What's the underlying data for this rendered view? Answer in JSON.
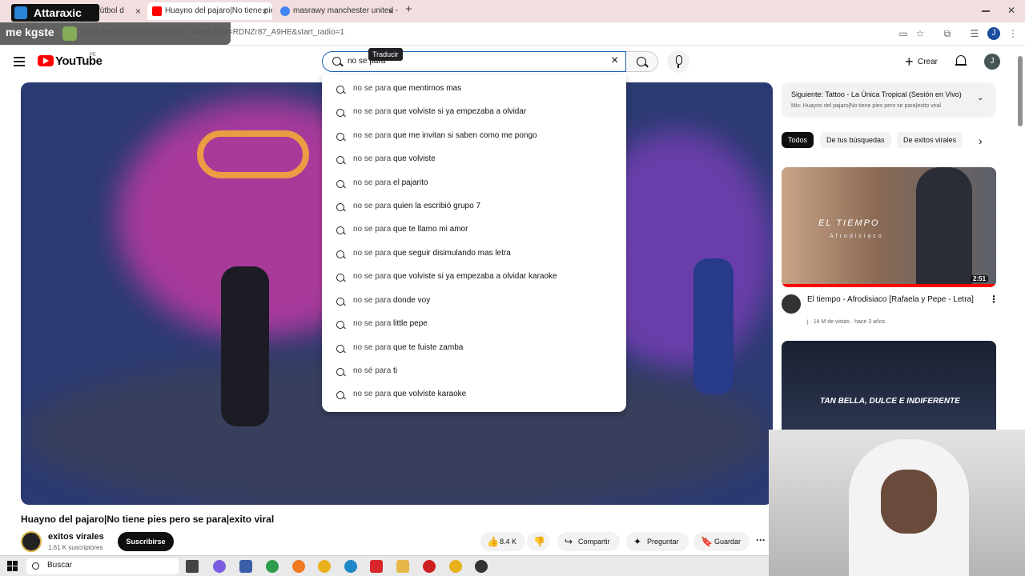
{
  "browser": {
    "tabs": [
      {
        "label": "fútbol d",
        "close": "×"
      },
      {
        "label": "Huayno del pajaro|No tiene pie",
        "close": "×"
      },
      {
        "label": "masrawy manchester united - B",
        "close": "×"
      }
    ],
    "new_tab": "+",
    "url": "youtube.com/watch?v=NZr87_A9HE&list=RDNZr87_A9HE&start_radio=1",
    "profile_initial": "J"
  },
  "overlay": {
    "brand": "Attaraxic",
    "streamer": "me kgste"
  },
  "yt": {
    "wordmark": "YouTube",
    "country": "PE",
    "search_query": "no se para",
    "translate_tip": "Traducir",
    "clear": "×",
    "create": "Crear",
    "avatar_initial": "J"
  },
  "suggestions": [
    {
      "prefix": "no se para",
      "rest": " que mentirnos mas"
    },
    {
      "prefix": "no se para",
      "rest": " que volviste si ya empezaba a olvidar"
    },
    {
      "prefix": "no se para",
      "rest": " que me invitan si saben como me pongo"
    },
    {
      "prefix": "no se para",
      "rest": " que volviste"
    },
    {
      "prefix": "no se para",
      "rest": " el pajarito"
    },
    {
      "prefix": "no se para",
      "rest": " quien la escribió grupo 7"
    },
    {
      "prefix": "no se para",
      "rest": " que te llamo mi amor"
    },
    {
      "prefix": "no se para",
      "rest": " que seguir disimulando mas letra"
    },
    {
      "prefix": "no se para",
      "rest": " que volviste si ya empezaba a olvidar karaoke"
    },
    {
      "prefix": "no se para",
      "rest": " donde voy"
    },
    {
      "prefix": "no se para",
      "rest": " little pepe"
    },
    {
      "prefix": "no se para",
      "rest": " que te fuiste zamba"
    },
    {
      "prefix": "no sé para",
      "rest": " ti"
    },
    {
      "prefix": "no se para",
      "rest": " que volviste karaoke"
    }
  ],
  "video": {
    "title": "Huayno del pajaro|No tiene pies pero se para|exito viral",
    "channel": "exitos virales",
    "subscribers": "1.61 K suscriptores",
    "subscribe": "Suscribirse",
    "likes": "8.4 K",
    "share": "Compartir",
    "ask": "Preguntar",
    "save": "Guardar",
    "more": "···"
  },
  "sidebar": {
    "next_label": "Siguiente: Tattoo - La Única Tropical (Sesión en Vivo)",
    "next_sub": "Mix: Huayno del pajaro|No tiene pies pero se para|exito viral",
    "chips": [
      "Todos",
      "De tus búsquedas",
      "De exitos virales"
    ],
    "rec1": {
      "overlay_title": "EL TIEMPO",
      "overlay_sub": "Afrodisiaco",
      "duration": "2:51",
      "title": "El tiempo - Afrodisiaco [Rafaela y Pepe - Letra]",
      "meta": "j · 14 M de vistas · hace 3 años"
    },
    "rec2": {
      "overlay_text": "TAN BELLA, DULCE E INDIFERENTE"
    }
  },
  "taskbar": {
    "search_label": "Buscar"
  },
  "icons": [
    "menu-icon",
    "youtube-logo-icon",
    "search-icon",
    "mic-icon",
    "bell-icon",
    "like-icon",
    "dislike-icon",
    "share-icon",
    "sparkle-icon",
    "bookmark-icon",
    "chevron-down-icon",
    "chevron-right-icon",
    "windows-start-icon"
  ],
  "colors": {
    "yt_red": "#ff0000",
    "accent_blue": "#1c62b9",
    "dark": "#0f0f0f"
  }
}
